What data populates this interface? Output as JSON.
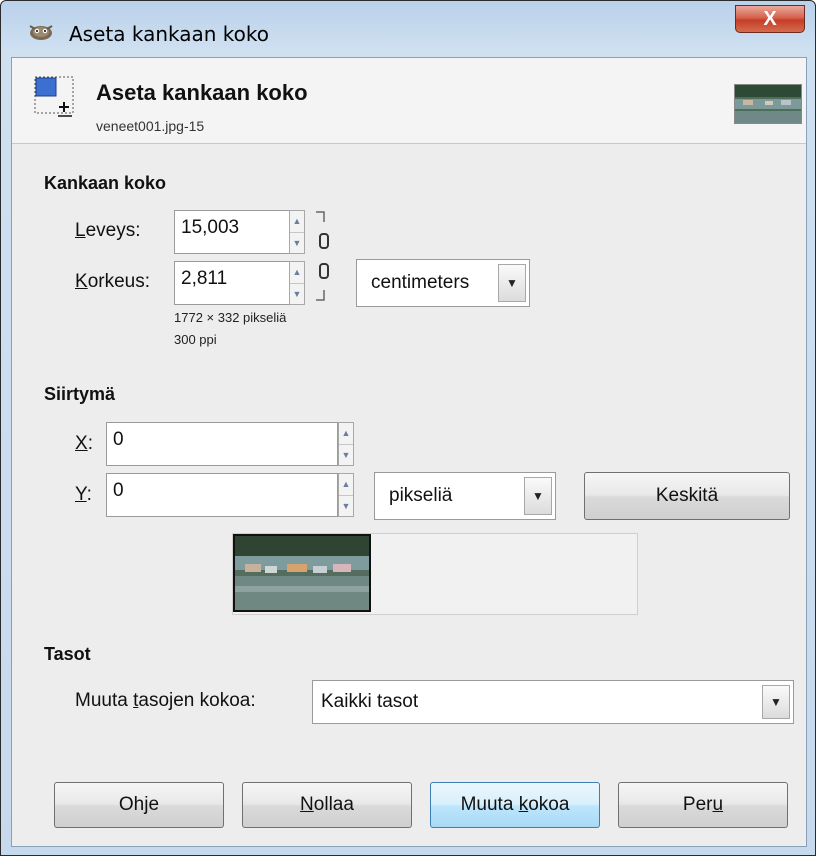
{
  "window": {
    "title": "Aseta kankaan koko",
    "close_label": "X"
  },
  "header": {
    "title": "Aseta kankaan koko",
    "subtitle": "veneet001.jpg-15"
  },
  "canvas_size": {
    "section_title": "Kankaan koko",
    "width_label_key": "L",
    "width_label_rest": "eveys:",
    "width_value": "15,003",
    "height_label_key": "K",
    "height_label_rest": "orkeus:",
    "height_value": "2,811",
    "unit": "centimeters",
    "pixel_info": "1772 × 332 pikseliä",
    "ppi_info": "300 ppi"
  },
  "offset": {
    "section_title": "Siirtymä",
    "x_label_key": "X",
    "x_label_rest": ":",
    "x_value": "0",
    "y_label_key": "Y",
    "y_label_rest": ":",
    "y_value": "0",
    "unit": "pikseliä",
    "center_label": "Keskitä"
  },
  "layers": {
    "section_title": "Tasot",
    "resize_label_pre": "Muuta ",
    "resize_label_key": "t",
    "resize_label_post": "asojen kokoa:",
    "resize_value": "Kaikki tasot"
  },
  "buttons": {
    "help_pre": "Oh",
    "help_key": "j",
    "help_post": "e",
    "reset_key": "N",
    "reset_post": "ollaa",
    "resize_pre": "Muuta ",
    "resize_key": "k",
    "resize_post": "okoa",
    "cancel_pre": "Per",
    "cancel_key": "u"
  },
  "icons": {
    "app": "gimp-icon",
    "header": "canvas-size-icon",
    "chain": "chain-link-icon",
    "dropdown": "chevron-down-icon"
  }
}
